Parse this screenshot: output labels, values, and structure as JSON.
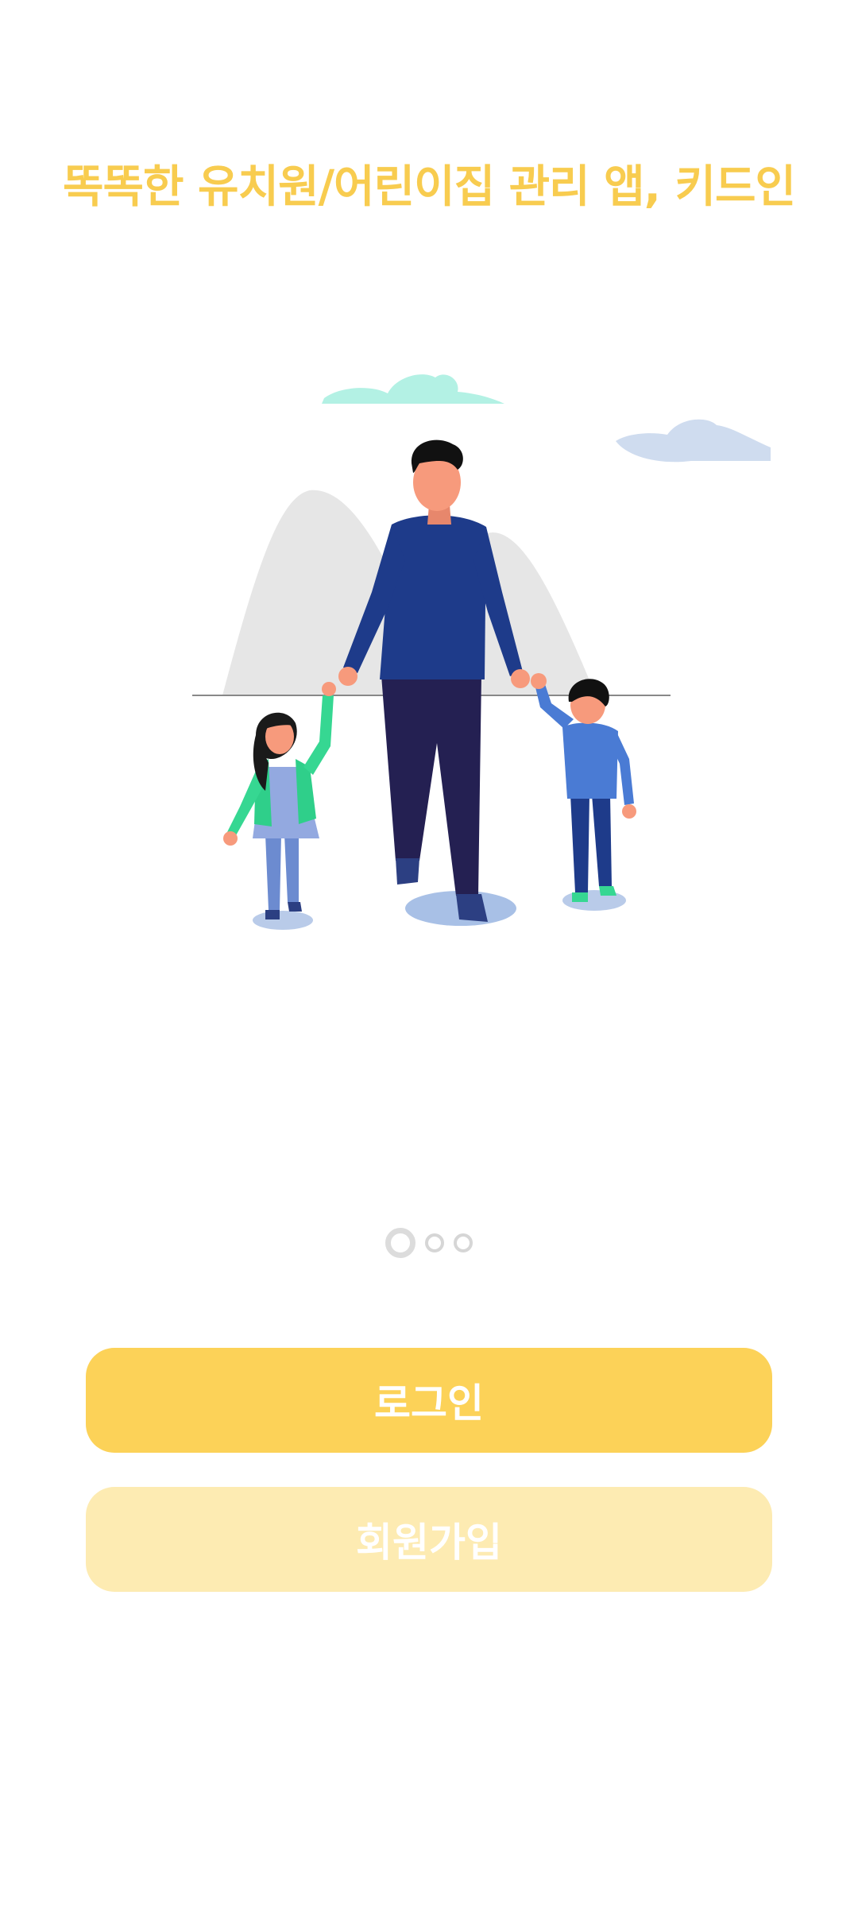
{
  "tagline": "똑똑한 유치원/어린이집 관리 앱, 키드인",
  "pager": {
    "total": 3,
    "current": 1
  },
  "buttons": {
    "login_label": "로그인",
    "signup_label": "회원가입"
  },
  "colors": {
    "tagline": "#f8cc4f",
    "login_button": "#fcd258",
    "signup_button": "#fdebb2",
    "pager_dot": "#d9d9d9"
  },
  "illustration": {
    "icon": "family-walking-illustration"
  }
}
